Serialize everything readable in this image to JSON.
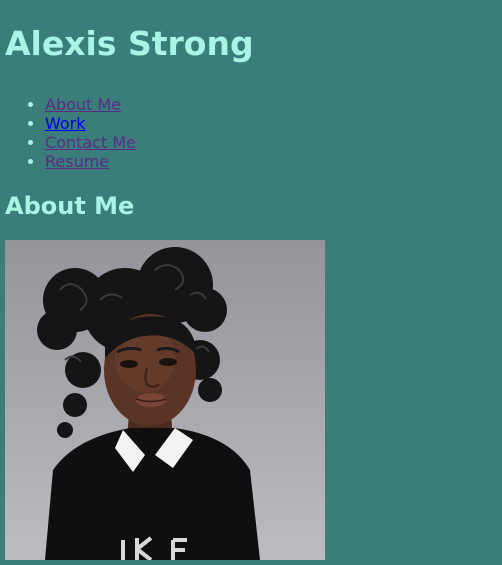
{
  "site": {
    "title": "Alexis Strong"
  },
  "nav": {
    "items": [
      {
        "label": "About Me",
        "active": false
      },
      {
        "label": "Work",
        "active": true
      },
      {
        "label": "Contact Me",
        "active": false
      },
      {
        "label": "Resume",
        "active": false
      }
    ]
  },
  "main": {
    "section_title": "About Me",
    "portrait_icon": "profile-portrait-image"
  },
  "colors": {
    "background": "#3a7d7a",
    "heading": "#a9f4e4",
    "visited_link": "#5b2b87",
    "link": "#0000ee"
  }
}
